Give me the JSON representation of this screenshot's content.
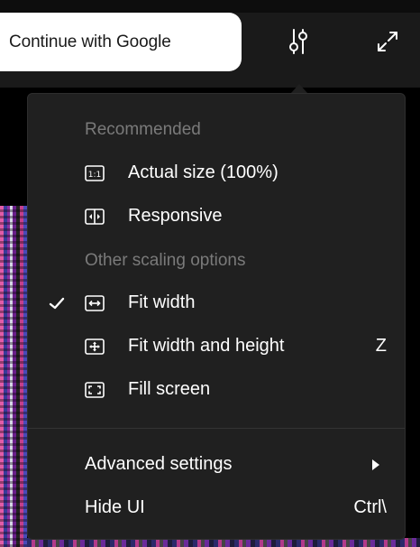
{
  "topbar": {
    "google_button_label": "Continue with Google",
    "settings_icon": "sliders-icon",
    "fullscreen_icon": "expand-icon"
  },
  "menu": {
    "sections": [
      {
        "heading": "Recommended",
        "items": [
          {
            "label": "Actual size (100%)",
            "icon": "actual-size-icon",
            "checked": false
          },
          {
            "label": "Responsive",
            "icon": "responsive-icon",
            "checked": false
          }
        ]
      },
      {
        "heading": "Other scaling options",
        "items": [
          {
            "label": "Fit width",
            "icon": "fit-width-icon",
            "checked": true
          },
          {
            "label": "Fit width and height",
            "icon": "fit-width-height-icon",
            "checked": false,
            "shortcut": "Z"
          },
          {
            "label": "Fill screen",
            "icon": "fill-screen-icon",
            "checked": false
          }
        ]
      }
    ],
    "footer_items": [
      {
        "label": "Advanced settings",
        "has_submenu": true
      },
      {
        "label": "Hide UI",
        "shortcut": "Ctrl\\"
      }
    ]
  },
  "colors": {
    "menu_background": "#202020",
    "heading_text": "#7a7a7a",
    "item_text": "#ffffff",
    "button_background": "#ffffff"
  }
}
